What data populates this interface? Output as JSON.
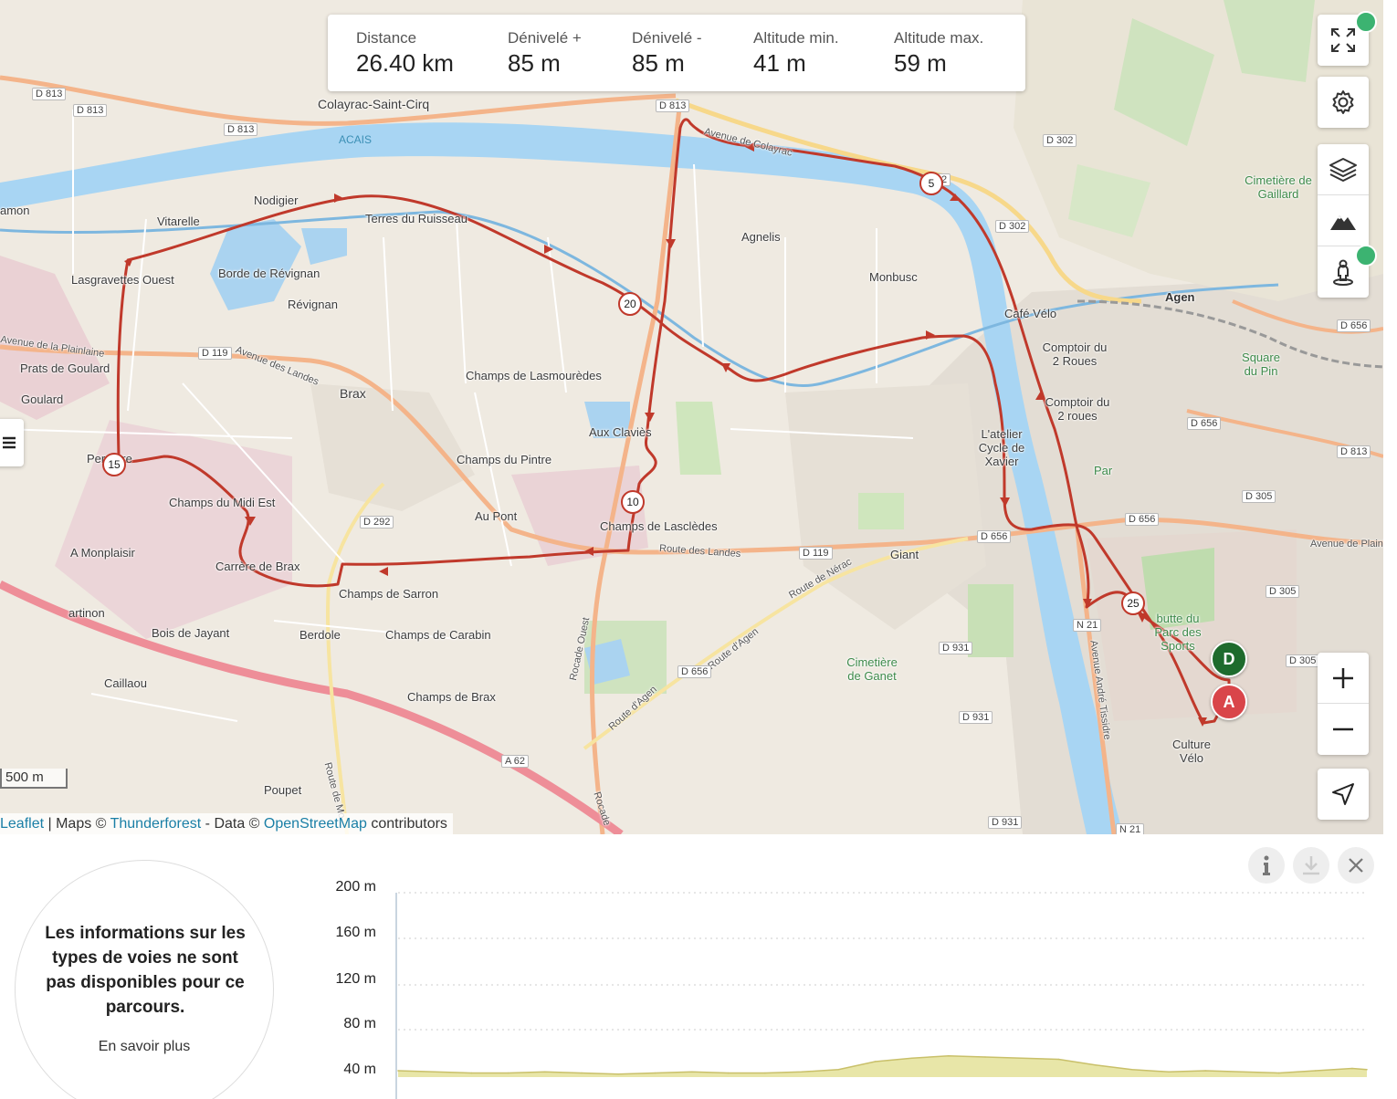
{
  "stats": {
    "distance": {
      "label": "Distance",
      "value": "26.40 km"
    },
    "ascent": {
      "label": "Dénivelé +",
      "value": "85 m"
    },
    "descent": {
      "label": "Dénivelé -",
      "value": "85 m"
    },
    "alt_min": {
      "label": "Altitude min.",
      "value": "41 m"
    },
    "alt_max": {
      "label": "Altitude max.",
      "value": "59 m"
    }
  },
  "map": {
    "places": [
      "Colayrac-Saint-Cirq",
      "ACAIS",
      "Nodigier",
      "Vitarelle",
      "amon",
      "Terres du Ruisseau",
      "Lasgravettes Ouest",
      "Borde de Révignan",
      "Révignan",
      "Agnelis",
      "Monbusc",
      "Agen",
      "Café Vélo",
      "Comptoir du 2 Roues",
      "Comptoir du 2 roues",
      "Cimetière de Gaillard",
      "Square du Pin",
      "Prats de Goulard",
      "Goulard",
      "Avenue des Landes",
      "Brax",
      "Champs de Lasmourèdes",
      "Aux Claviès",
      "L'atelier Cycle de Xavier",
      "Perreyre",
      "Champs du Midi Est",
      "Champs du Pintre",
      "Au Pont",
      "Champs de Lasclèdes",
      "Giant",
      "A Monplaisir",
      "Carrère de Brax",
      "Champs de Sarron",
      "artinon",
      "Bois de Jayant",
      "Berdole",
      "Champs de Carabin",
      "Caillaou",
      "Champs de Brax",
      "Cimetière de Ganet",
      "butte du Parc des Sports",
      "Culture Vélo",
      "Poupet",
      "Rocade Ouest",
      "Route d'Agen",
      "Route de Nérac",
      "Route des Landes",
      "Avenue André Tissidre",
      "Avenue de Plainlaine",
      "Route d'Agen",
      "Par",
      "Rocade",
      "Avenue de la Plainlaine",
      "Avenue de Colayrac",
      "Route de Mo"
    ],
    "roads": [
      "D 813",
      "D 813",
      "D 813",
      "D 813",
      "D 302",
      "D 302",
      "D 119",
      "D 292",
      "D 656",
      "D 119",
      "D 656",
      "D 656",
      "D 656",
      "D 813",
      "D 305",
      "D 305",
      "D 305",
      "N 21",
      "N 21",
      "D 931",
      "D 931",
      "D 931",
      "A 62",
      "D 656",
      "N 2"
    ],
    "km_markers": [
      "5",
      "10",
      "15",
      "20",
      "25"
    ],
    "start_marker": "D",
    "end_marker": "A",
    "scale": "500 m",
    "attribution": {
      "leaflet": "Leaflet",
      "sep1": " | Maps © ",
      "tf": "Thunderforest",
      "sep2": " - Data © ",
      "osm": "OpenStreetMap",
      "tail": " contributors"
    }
  },
  "controls": [
    "fullscreen-icon",
    "gear-icon",
    "layers-icon",
    "mountain-icon",
    "pegman-icon",
    "plus-icon",
    "minus-icon",
    "locate-icon"
  ],
  "waytypes": {
    "message": "Les informations sur les types de voies ne sont pas disponibles pour ce parcours.",
    "more": "En savoir plus"
  },
  "chart_data": {
    "type": "area",
    "y_ticks": [
      "200 m",
      "160 m",
      "120 m",
      "80 m",
      "40 m"
    ],
    "ylim": [
      40,
      200
    ],
    "x": [
      0,
      1,
      2,
      3,
      4,
      5,
      6,
      7,
      8,
      9,
      10,
      11,
      12,
      13,
      14,
      15,
      16,
      17,
      18,
      19,
      20,
      21,
      22,
      23,
      24,
      25,
      26,
      26.4
    ],
    "y": [
      44,
      43,
      42,
      42,
      43,
      42,
      41,
      42,
      43,
      42,
      42,
      43,
      45,
      52,
      55,
      57,
      56,
      55,
      54,
      49,
      45,
      43,
      44,
      43,
      42,
      44,
      46,
      45
    ],
    "colors": {
      "fill": "#e8e6a8",
      "stroke": "#c9c06a"
    }
  }
}
